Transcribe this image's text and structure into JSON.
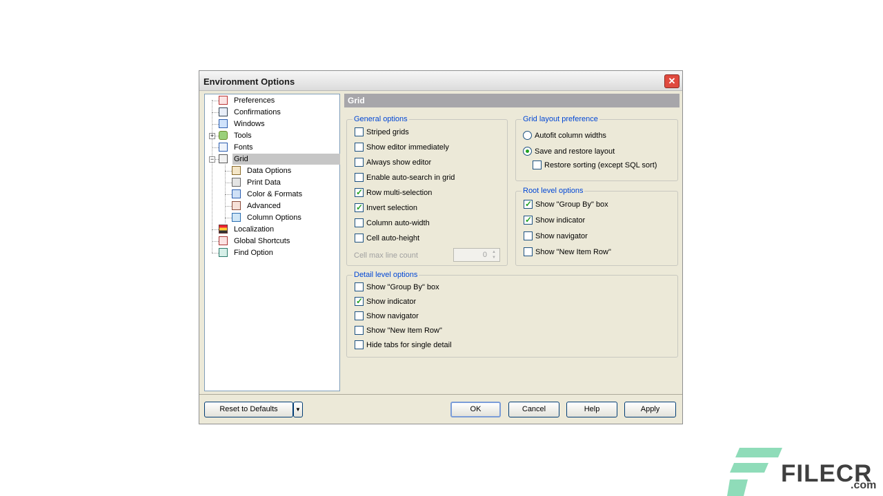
{
  "dialog": {
    "title": "Environment Options",
    "close_icon": "close-icon"
  },
  "tree": {
    "items": [
      {
        "label": "Preferences",
        "icon": "preferences-icon"
      },
      {
        "label": "Confirmations",
        "icon": "confirmations-icon"
      },
      {
        "label": "Windows",
        "icon": "windows-icon"
      },
      {
        "label": "Tools",
        "icon": "tools-icon"
      },
      {
        "label": "Fonts",
        "icon": "fonts-icon"
      },
      {
        "label": "Grid",
        "icon": "grid-icon"
      },
      {
        "label": "Data Options",
        "icon": "data-options-icon"
      },
      {
        "label": "Print Data",
        "icon": "printer-icon"
      },
      {
        "label": "Color & Formats",
        "icon": "color-formats-icon"
      },
      {
        "label": "Advanced",
        "icon": "advanced-icon"
      },
      {
        "label": "Column Options",
        "icon": "column-options-icon"
      },
      {
        "label": "Localization",
        "icon": "localization-icon"
      },
      {
        "label": "Global Shortcuts",
        "icon": "shortcuts-icon"
      },
      {
        "label": "Find Option",
        "icon": "find-icon"
      }
    ],
    "expander_plus": "+",
    "expander_minus": "−"
  },
  "panel": {
    "header": "Grid",
    "general": {
      "title": "General options",
      "items": [
        {
          "label": "Striped grids",
          "checked": false
        },
        {
          "label": "Show editor immediately",
          "checked": false
        },
        {
          "label": "Always show editor",
          "checked": false
        },
        {
          "label": "Enable auto-search in grid",
          "checked": false
        },
        {
          "label": "Row multi-selection",
          "checked": true
        },
        {
          "label": "Invert selection",
          "checked": true
        },
        {
          "label": "Column auto-width",
          "checked": false
        },
        {
          "label": "Cell auto-height",
          "checked": false
        }
      ],
      "cell_max_label": "Cell max line count",
      "cell_max_value": "0"
    },
    "layout": {
      "title": "Grid layout preference",
      "autofit": "Autofit column widths",
      "save_restore": "Save and restore layout",
      "selected": "save_restore",
      "restore_sorting": "Restore sorting (except SQL sort)",
      "restore_sorting_checked": false
    },
    "root": {
      "title": "Root level options",
      "items": [
        {
          "label": "Show \"Group By\" box",
          "checked": true
        },
        {
          "label": "Show indicator",
          "checked": true
        },
        {
          "label": "Show navigator",
          "checked": false
        },
        {
          "label": "Show \"New Item Row\"",
          "checked": false
        }
      ]
    },
    "detail": {
      "title": "Detail level options",
      "items": [
        {
          "label": "Show \"Group By\" box",
          "checked": false
        },
        {
          "label": "Show indicator",
          "checked": true
        },
        {
          "label": "Show navigator",
          "checked": false
        },
        {
          "label": "Show \"New Item Row\"",
          "checked": false
        },
        {
          "label": "Hide tabs for single detail",
          "checked": false
        }
      ]
    }
  },
  "footer": {
    "reset": "Reset to Defaults",
    "ok": "OK",
    "cancel": "Cancel",
    "help": "Help",
    "apply": "Apply"
  },
  "watermark": {
    "brand": "FILECR",
    "domain": ".com"
  },
  "colors": {
    "group_title": "#0046d5",
    "check": "#21a121",
    "header_bar": "#a7a6aa"
  }
}
